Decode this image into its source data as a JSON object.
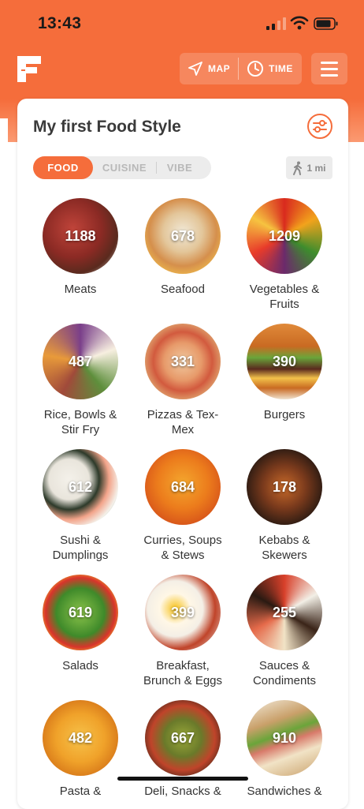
{
  "status_bar": {
    "time": "13:43"
  },
  "header": {
    "map_label": "MAP",
    "time_label": "TIME",
    "icons": [
      "logo-icon",
      "navigation-arrow-icon",
      "clock-icon",
      "hamburger-menu-icon"
    ]
  },
  "card": {
    "title": "My first Food Style",
    "tabs": [
      {
        "label": "FOOD",
        "active": true
      },
      {
        "label": "CUISINE",
        "active": false
      },
      {
        "label": "VIBE",
        "active": false
      }
    ],
    "distance": "1 mi"
  },
  "categories": [
    {
      "count": "1188",
      "label": "Meats",
      "label2": ""
    },
    {
      "count": "678",
      "label": "Seafood",
      "label2": ""
    },
    {
      "count": "1209",
      "label": "Vegetables &",
      "label2": "Fruits"
    },
    {
      "count": "487",
      "label": "Rice, Bowls &",
      "label2": "Stir Fry"
    },
    {
      "count": "331",
      "label": "Pizzas & Tex-",
      "label2": "Mex"
    },
    {
      "count": "390",
      "label": "Burgers",
      "label2": ""
    },
    {
      "count": "612",
      "label": "Sushi &",
      "label2": "Dumplings"
    },
    {
      "count": "684",
      "label": "Curries, Soups",
      "label2": "& Stews"
    },
    {
      "count": "178",
      "label": "Kebabs &",
      "label2": "Skewers"
    },
    {
      "count": "619",
      "label": "Salads",
      "label2": ""
    },
    {
      "count": "399",
      "label": "Breakfast,",
      "label2": "Brunch & Eggs"
    },
    {
      "count": "255",
      "label": "Sauces &",
      "label2": "Condiments"
    },
    {
      "count": "482",
      "label": "Pasta &",
      "label2": ""
    },
    {
      "count": "667",
      "label": "Deli, Snacks &",
      "label2": ""
    },
    {
      "count": "910",
      "label": "Sandwiches &",
      "label2": ""
    }
  ],
  "colors": {
    "accent": "#f56d3b",
    "text": "#333333",
    "muted": "#b8b8b8"
  }
}
